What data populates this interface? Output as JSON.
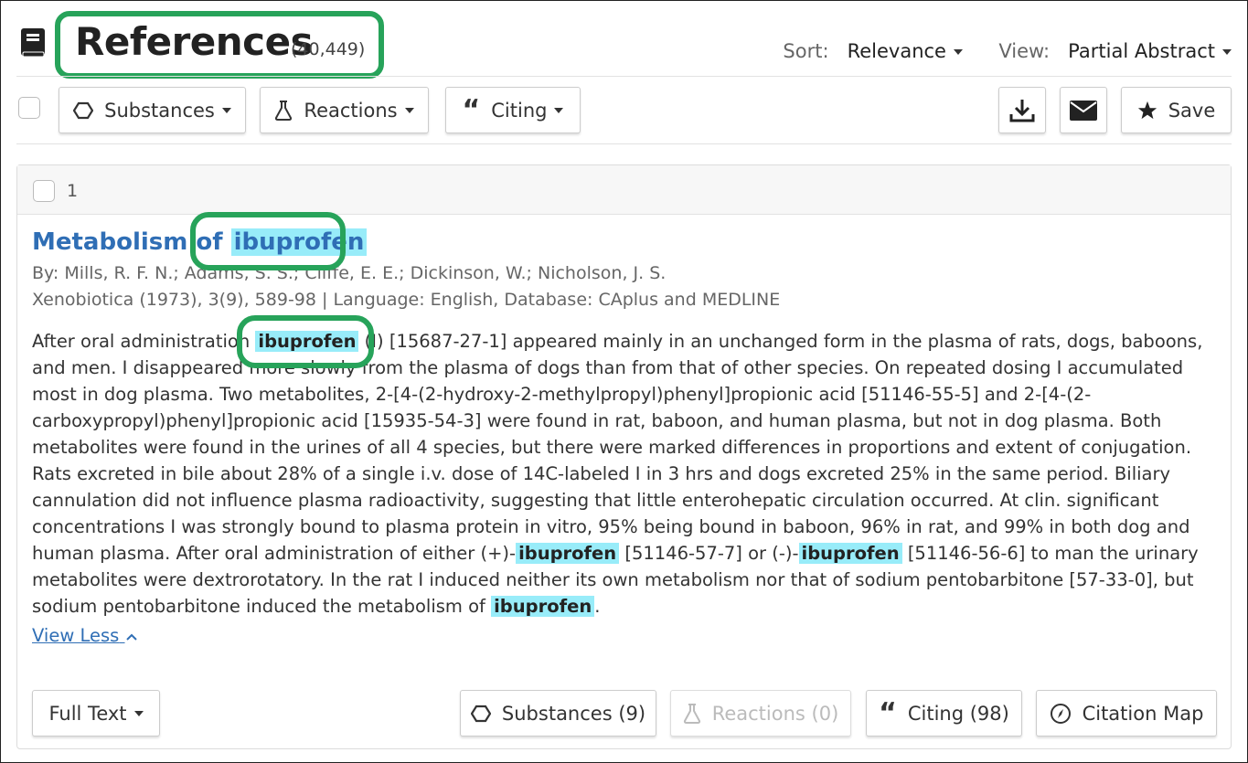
{
  "header": {
    "title": "References",
    "count": "(40,449)",
    "sort_label": "Sort:",
    "sort_value": "Relevance",
    "view_label": "View:",
    "view_value": "Partial Abstract"
  },
  "toolbar": {
    "substances_label": "Substances",
    "reactions_label": "Reactions",
    "citing_label": "Citing",
    "save_label": "Save"
  },
  "result": {
    "number": "1",
    "title_prefix": "Metabolism of ",
    "title_highlight": "ibuprofen",
    "authors": "By: Mills, R. F. N.; Adams, S. S.; Cliffe, E. E.; Dickinson, W.; Nicholson, J. S.",
    "source": "Xenobiotica (1973), 3(9), 589-98 | Language: English, Database: CAplus and MEDLINE",
    "abstract": {
      "l1_a": "After oral administration ",
      "l1_hl": "ibuprofen",
      "l1_b": " (I) [15687-27-1] appeared mainly in an unchanged form in the plasma of rats, dogs, baboons,",
      "l2": "and men. I disappeared more slowly from the plasma of dogs than from that of other species. On repeated dosing I accumulated",
      "l3": "most in dog plasma. Two metabolites, 2-[4-(2-hydroxy-2-methylpropyl)phenyl]propionic acid [51146-55-5] and 2-[4-(2-",
      "l4": "carboxypropyl)phenyl]propionic acid [15935-54-3] were found in rat, baboon, and human plasma, but not in dog plasma. Both",
      "l5": "metabolites were found in the urines of all 4 species, but there were marked differences in proportions and extent of conjugation.",
      "l6": "Rats excreted in bile about 28% of a single i.v. dose of 14C-labeled I in 3 hrs and dogs excreted 25% in the same period. Biliary",
      "l7": "cannulation did not influence plasma radioactivity, suggesting that little enterohepatic circulation occurred. At clin. significant",
      "l8": "concentrations I was strongly bound to plasma protein in vitro, 95% being bound in baboon, 96% in rat, and 99% in both dog and",
      "l9_a": "human plasma. After oral administration of either (+)-",
      "l9_hl1": "ibuprofen",
      "l9_b": " [51146-57-7] or (-)-",
      "l9_hl2": "ibuprofen",
      "l9_c": " [51146-56-6] to man the urinary",
      "l10": "metabolites were dextrorotatory. In the rat I induced neither its own metabolism nor that of sodium pentobarbitone [57-33-0], but",
      "l11_a": "sodium pentobarbitone induced the metabolism of ",
      "l11_hl": "ibuprofen",
      "l11_b": "."
    },
    "view_less": "View Less",
    "actions": {
      "full_text": "Full Text",
      "substances": "Substances (9)",
      "reactions": "Reactions (0)",
      "citing": "Citing (98)",
      "citation_map": "Citation Map"
    }
  },
  "colors": {
    "highlight": "#98ecf9",
    "link": "#2f6eb5",
    "annotation_ring": "#27a35a"
  }
}
